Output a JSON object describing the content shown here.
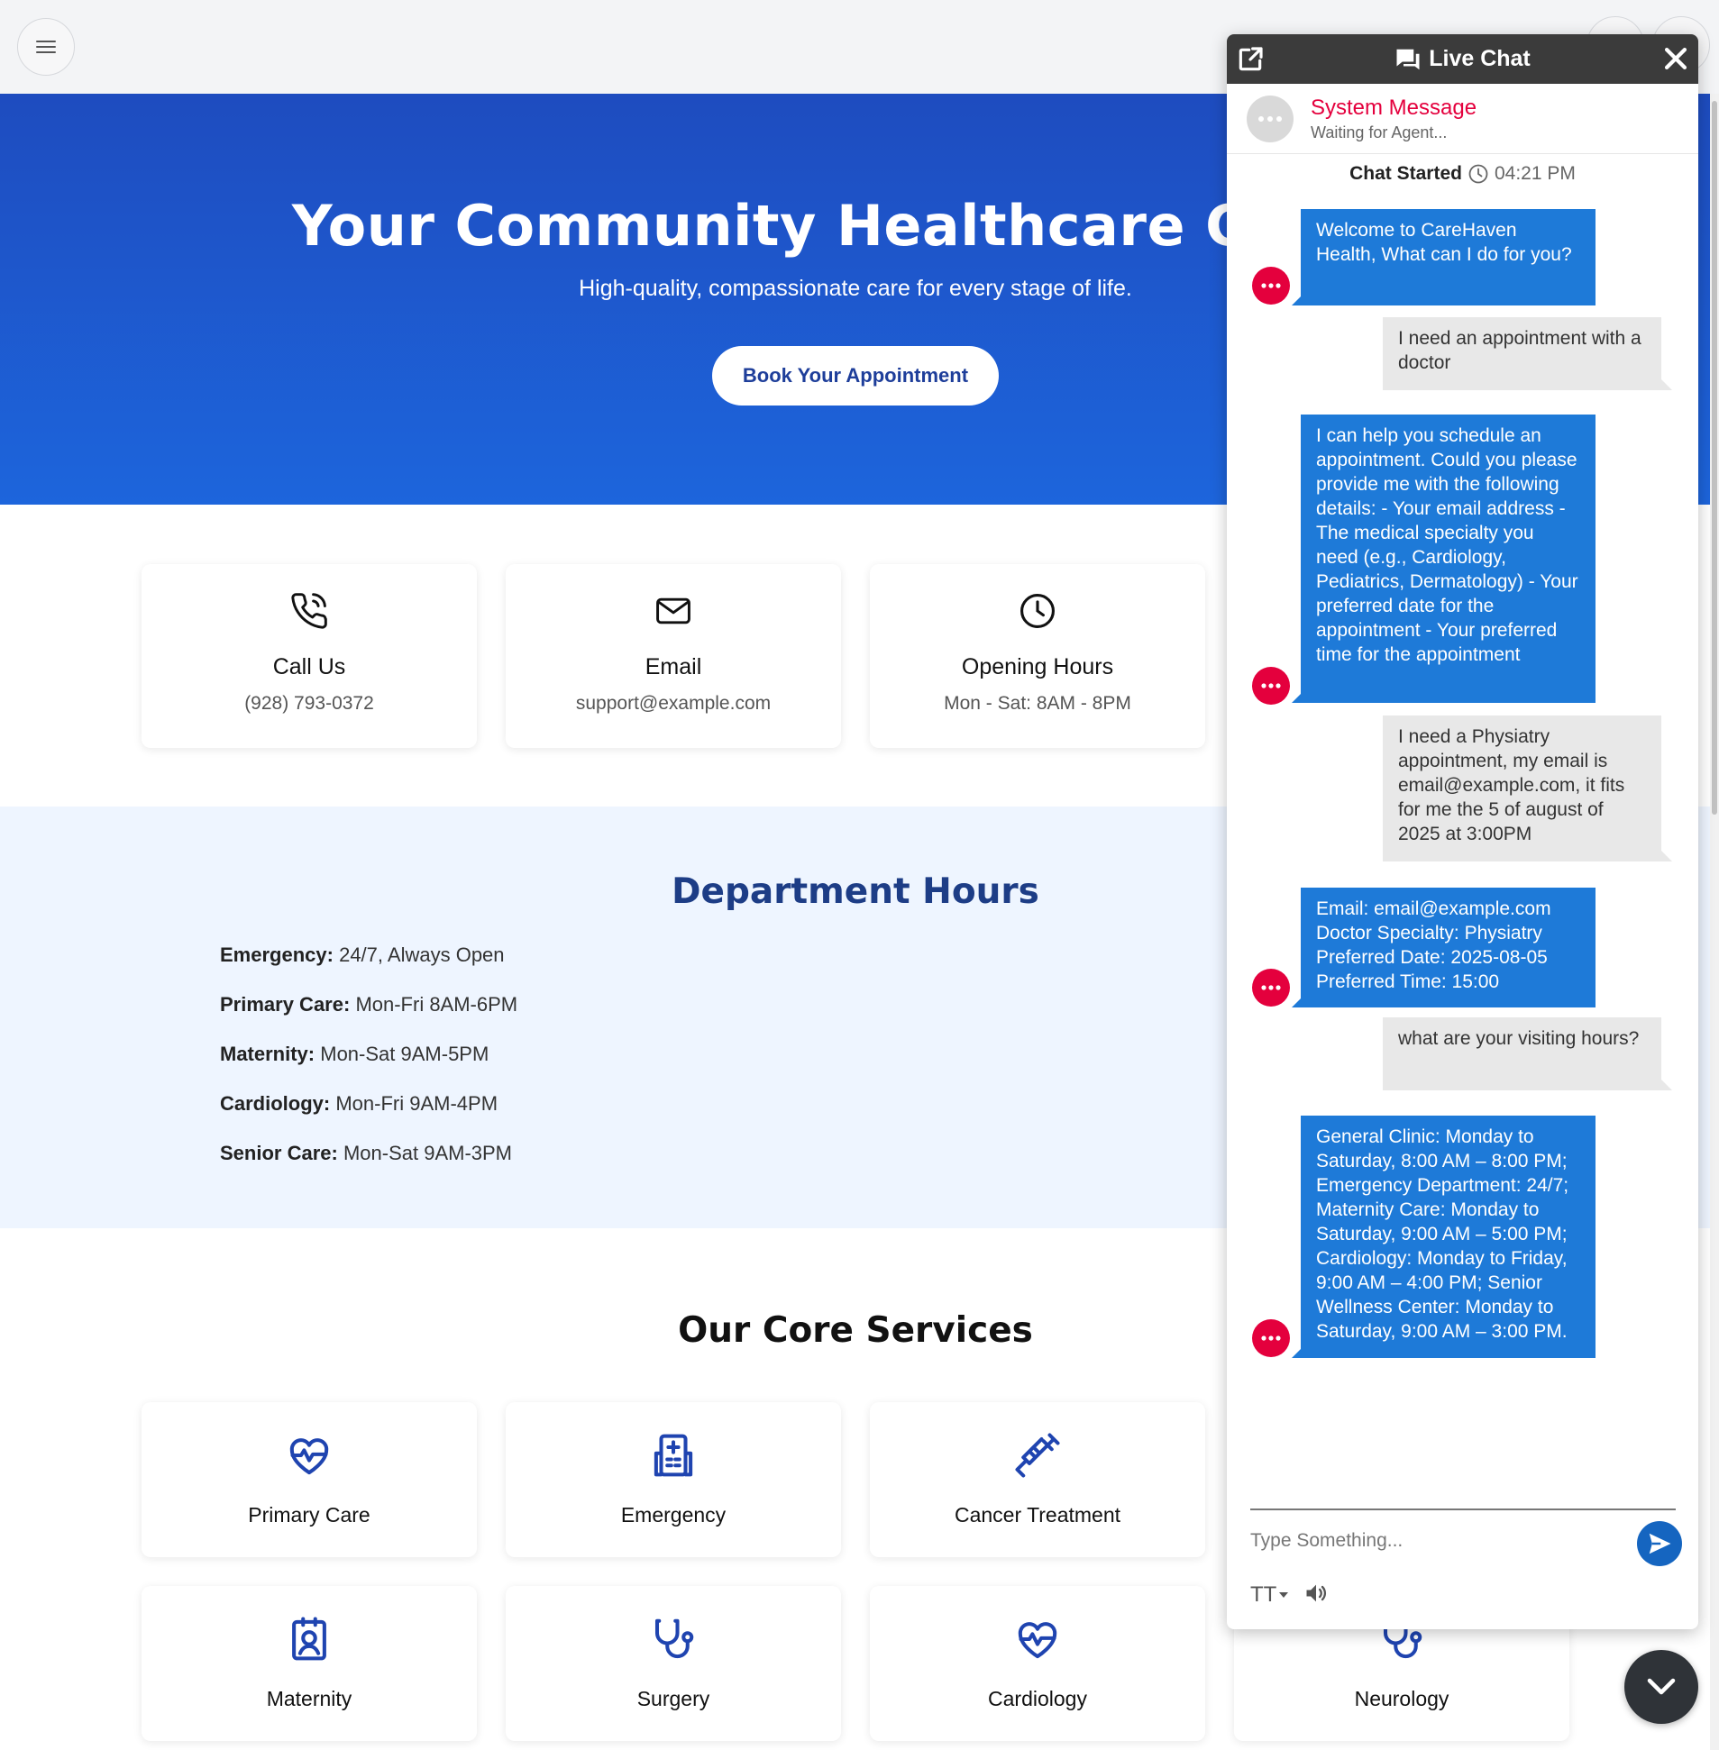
{
  "hero": {
    "title": "Your Community Healthcare Center",
    "subtitle": "High-quality, compassionate care for every stage of life.",
    "cta_label": "Book Your Appointment"
  },
  "contact_cards": [
    {
      "title": "Call Us",
      "value": "(928) 793-0372",
      "icon": "phone-icon"
    },
    {
      "title": "Email",
      "value": "support@example.com",
      "icon": "mail-icon"
    },
    {
      "title": "Opening Hours",
      "value": "Mon - Sat: 8AM - 8PM",
      "icon": "clock-icon"
    }
  ],
  "department_hours": {
    "title": "Department Hours",
    "rows": [
      {
        "name": "Emergency:",
        "hours": "24/7, Always Open"
      },
      {
        "name": "Primary Care:",
        "hours": "Mon-Fri 8AM-6PM"
      },
      {
        "name": "Maternity:",
        "hours": "Mon-Sat 9AM-5PM"
      },
      {
        "name": "Cardiology:",
        "hours": "Mon-Fri 9AM-4PM"
      },
      {
        "name": "Senior Care:",
        "hours": "Mon-Sat 9AM-3PM"
      }
    ]
  },
  "services": {
    "title": "Our Core Services",
    "items": [
      {
        "label": "Primary Care",
        "icon": "heart-pulse-icon"
      },
      {
        "label": "Emergency",
        "icon": "hospital-icon"
      },
      {
        "label": "Cancer Treatment",
        "icon": "syringe-icon"
      },
      {
        "label": "Maternity",
        "icon": "id-badge-icon"
      },
      {
        "label": "Surgery",
        "icon": "stethoscope-icon"
      },
      {
        "label": "Cardiology",
        "icon": "heart-pulse-icon"
      },
      {
        "label": "Neurology",
        "icon": "stethoscope-icon"
      }
    ]
  },
  "chat": {
    "header_title": "Live Chat",
    "agent_name": "System Message",
    "agent_status": "Waiting for Agent...",
    "started_label": "Chat Started",
    "started_time": "04:21 PM",
    "messages": [
      {
        "from": "bot",
        "text": "Welcome to CareHaven Health, What can I do for you?"
      },
      {
        "from": "user",
        "text": "I need an appointment with a doctor"
      },
      {
        "from": "bot",
        "text": "I can help you schedule an appointment. Could you please provide me with the following details: - Your email address - The medical specialty you need (e.g., Cardiology, Pediatrics, Dermatology) - Your preferred date for the appointment - Your preferred time for the appointment"
      },
      {
        "from": "user",
        "text": "I need a Physiatry appointment, my email is email@example.com, it fits for me the 5 of august of 2025 at 3:00PM"
      },
      {
        "from": "bot",
        "text": "Email: email@example.com Doctor Specialty: Physiatry Preferred Date: 2025-08-05 Preferred Time: 15:00"
      },
      {
        "from": "user",
        "text": "what are your visiting hours?"
      },
      {
        "from": "bot",
        "text": "General Clinic: Monday to Saturday, 8:00 AM – 8:00 PM; Emergency Department: 24/7; Maternity Care: Monday to Saturday, 9:00 AM – 5:00 PM; Cardiology: Monday to Friday, 9:00 AM – 4:00 PM; Senior Wellness Center: Monday to Saturday, 9:00 AM – 3:00 PM."
      }
    ],
    "input_placeholder": "Type Something...",
    "font_tool_label": "TT"
  },
  "colors": {
    "hero_top": "#1e4cbf",
    "hero_bottom": "#1d65dc",
    "brand_blue": "#1e3e9a",
    "icon_blue": "#1f44b0",
    "bot_bubble": "#1e7ad8",
    "user_bubble": "#e8e8e8",
    "alert_red": "#e4003d"
  }
}
